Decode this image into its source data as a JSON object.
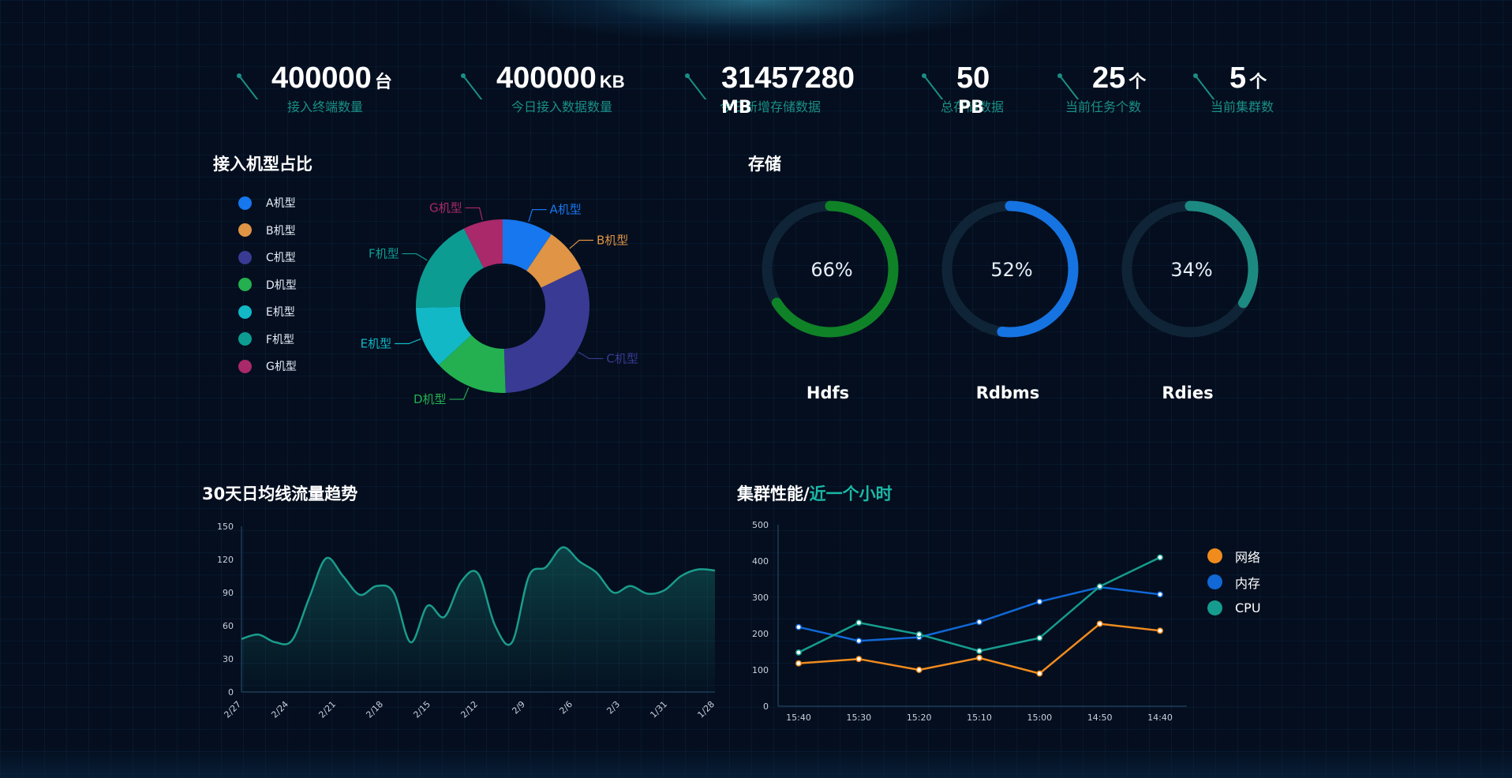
{
  "stats": [
    {
      "value": "400000",
      "unit": "台",
      "label": "接入终端数量"
    },
    {
      "value": "400000",
      "unit": "KB",
      "label": "今日接入数据数量"
    },
    {
      "value": "31457280",
      "unit": "MB",
      "label": "今日新增存储数据"
    },
    {
      "value": "50",
      "unit": "PB",
      "label": "总存储数据"
    },
    {
      "value": "25",
      "unit": "个",
      "label": "当前任务个数"
    },
    {
      "value": "5",
      "unit": "个",
      "label": "当前集群数"
    }
  ],
  "sections": {
    "model_share": "接入机型占比",
    "storage": "存储",
    "trend": "30天日均线流量趋势",
    "perf_prefix": "集群性能/",
    "perf_accent": "近一个小时"
  },
  "colors": {
    "accent": "#1bb8a5",
    "background": "#040e1e"
  },
  "chart_data": [
    {
      "type": "pie",
      "variant": "donut",
      "categories": [
        "A机型",
        "B机型",
        "C机型",
        "D机型",
        "E机型",
        "F机型",
        "G机型"
      ],
      "values": [
        9,
        8,
        30,
        13,
        11,
        17,
        7
      ],
      "colors": [
        "#1677ee",
        "#df9446",
        "#393a93",
        "#24b050",
        "#12b8c6",
        "#0d9c92",
        "#a9296a"
      ],
      "legend_position": "left"
    },
    {
      "type": "gauge",
      "items": [
        {
          "name": "Hdfs",
          "value": 66,
          "display": "66%",
          "color": "#0f8227"
        },
        {
          "name": "Rdbms",
          "value": 52,
          "display": "52%",
          "color": "#1673e2"
        },
        {
          "name": "Rdies",
          "value": 34,
          "display": "34%",
          "color": "#1d8a82"
        }
      ]
    },
    {
      "type": "area",
      "x": [
        "2/27",
        "2/26",
        "2/25",
        "2/24",
        "2/23",
        "2/22",
        "2/21",
        "2/20",
        "2/19",
        "2/18",
        "2/17",
        "2/16",
        "2/15",
        "2/14",
        "2/13",
        "2/12",
        "2/11",
        "2/10",
        "2/9",
        "2/8",
        "2/7",
        "2/6",
        "2/5",
        "2/4",
        "2/3",
        "2/2",
        "2/1",
        "1/31",
        "1/30",
        "1/29",
        "1/28"
      ],
      "xticks": [
        "2/27",
        "2/24",
        "2/21",
        "2/18",
        "2/15",
        "2/12",
        "2/9",
        "2/6",
        "2/3",
        "1/31",
        "1/28"
      ],
      "values": [
        48,
        52,
        45,
        47,
        85,
        121,
        105,
        88,
        96,
        90,
        45,
        78,
        68,
        100,
        107,
        60,
        45,
        105,
        113,
        131,
        118,
        108,
        90,
        96,
        89,
        92,
        105,
        111,
        110
      ],
      "ylim": [
        0,
        150
      ],
      "yticks": [
        0,
        30,
        60,
        90,
        120,
        150
      ],
      "color": "#1b9c8c",
      "grid": false
    },
    {
      "type": "line",
      "categories": [
        "15:40",
        "15:30",
        "15:20",
        "15:10",
        "15:00",
        "14:50",
        "14:40"
      ],
      "series": [
        {
          "name": "网络",
          "values": [
            118,
            130,
            100,
            133,
            90,
            227,
            208
          ],
          "color": "#f08b1e"
        },
        {
          "name": "内存",
          "values": [
            218,
            180,
            190,
            232,
            288,
            328,
            308
          ],
          "color": "#1168d6"
        },
        {
          "name": "CPU",
          "values": [
            148,
            230,
            198,
            152,
            188,
            330,
            410
          ],
          "color": "#169c8e"
        }
      ],
      "ylim": [
        0,
        500
      ],
      "yticks": [
        0,
        100,
        200,
        300,
        400,
        500
      ],
      "legend_position": "right"
    }
  ]
}
